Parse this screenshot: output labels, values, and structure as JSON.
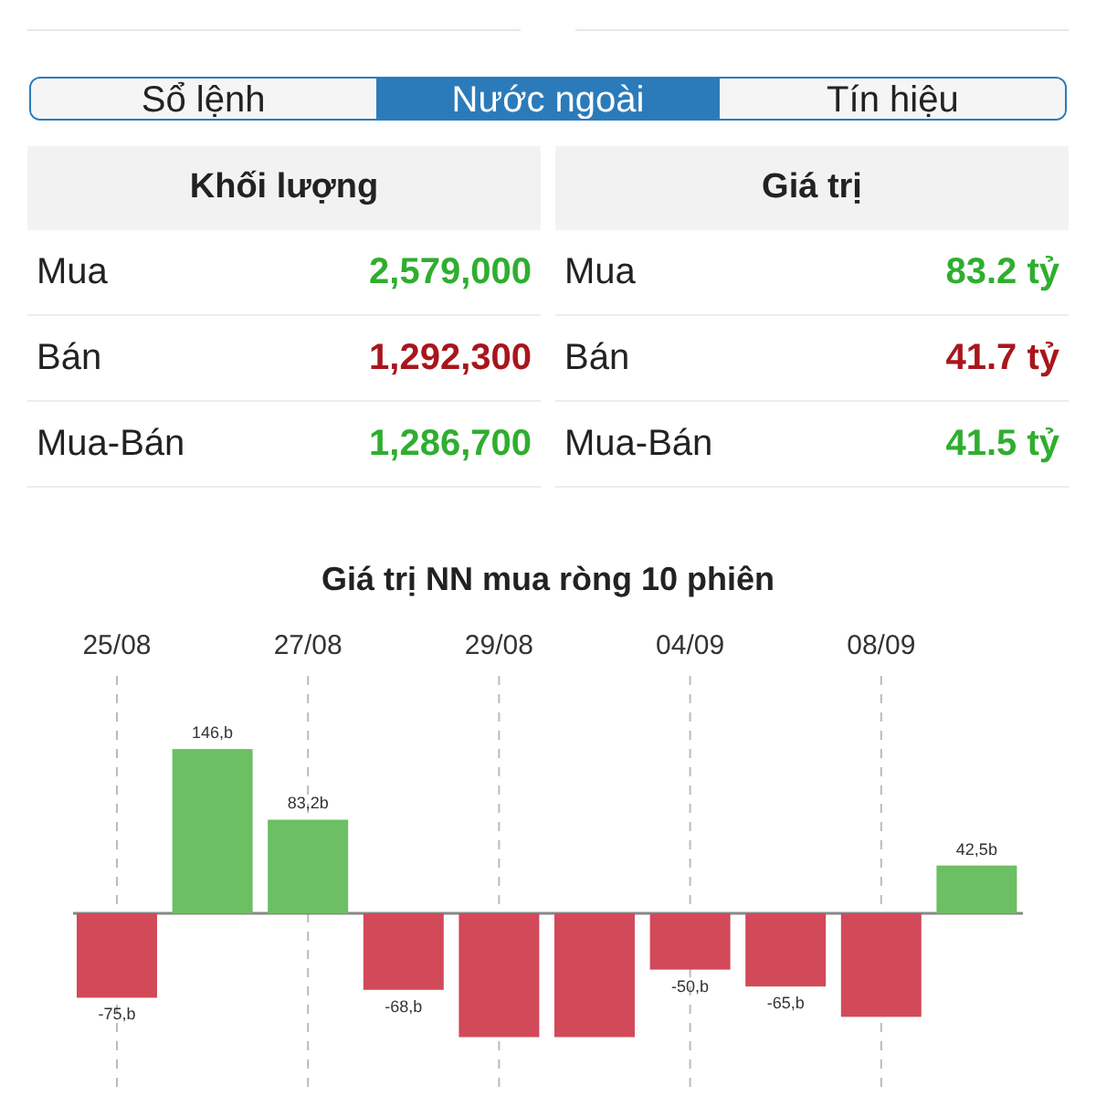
{
  "tabs": [
    {
      "label": "Sổ lệnh",
      "selected": false
    },
    {
      "label": "Nước ngoài",
      "selected": true
    },
    {
      "label": "Tín hiệu",
      "selected": false
    }
  ],
  "panels": [
    {
      "header": "Khối lượng",
      "rows": [
        {
          "label": "Mua",
          "value": "2,579,000",
          "color": "#2fae2f"
        },
        {
          "label": "Bán",
          "value": "1,292,300",
          "color": "#a8161c"
        },
        {
          "label": "Mua-Bán",
          "value": "1,286,700",
          "color": "#2fae2f"
        }
      ]
    },
    {
      "header": "Giá trị",
      "rows": [
        {
          "label": "Mua",
          "value": "83.2 tỷ",
          "color": "#2fae2f"
        },
        {
          "label": "Bán",
          "value": "41.7 tỷ",
          "color": "#a8161c"
        },
        {
          "label": "Mua-Bán",
          "value": "41.5 tỷ",
          "color": "#2fae2f"
        }
      ]
    }
  ],
  "chart": {
    "chart_data": {
      "type": "bar",
      "title": "Giá trị NN mua ròng 10 phiên",
      "grid": true,
      "stacked": true,
      "categories": [
        "25/08",
        null,
        "27/08",
        null,
        "29/08",
        null,
        "04/09",
        null,
        "08/09",
        null
      ],
      "series": [
        {
          "color": "#6cbf63",
          "values": [
            null,
            146,
            83.2,
            null,
            null,
            null,
            null,
            null,
            null,
            42.5
          ],
          "value_labels": [
            null,
            "146,b",
            "83,2b",
            null,
            null,
            null,
            null,
            null,
            null,
            "42,5b"
          ]
        },
        {
          "color": "#d24a59",
          "values": [
            -75,
            null,
            null,
            -68,
            -110,
            -110,
            -50,
            -65,
            -92,
            null
          ],
          "value_labels": [
            "-75,b",
            null,
            null,
            "-68,b",
            null,
            null,
            "-50,b",
            "-65,b",
            null,
            null
          ]
        }
      ]
    }
  }
}
